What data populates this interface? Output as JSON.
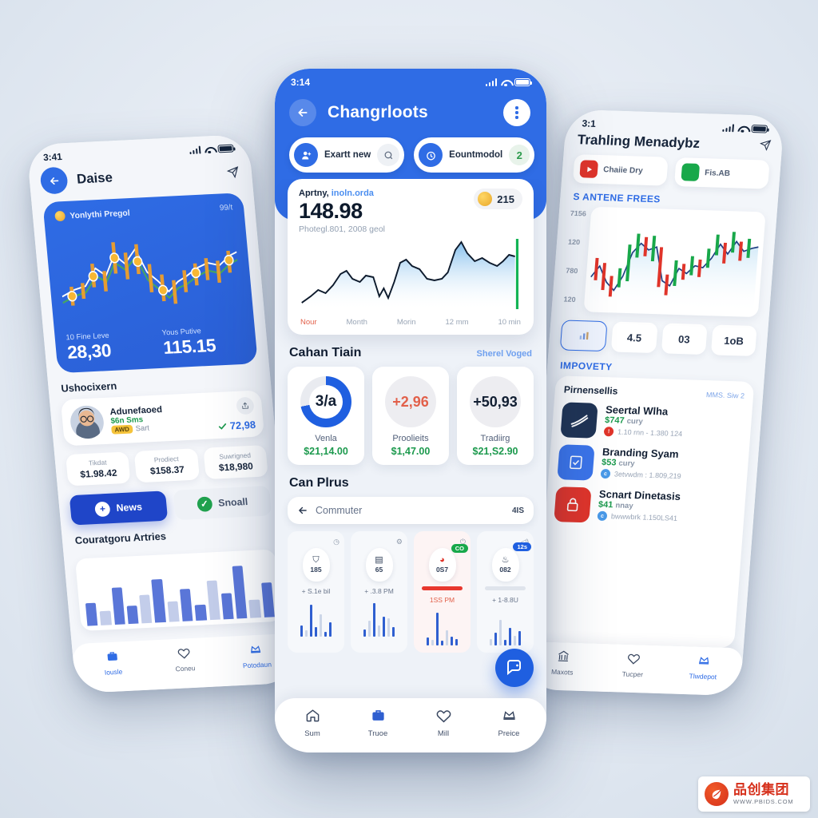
{
  "background_color": "#e6ecf4",
  "accent_blue": "#2f6ce5",
  "accent_green": "#1d9a4e",
  "accent_red": "#e2604a",
  "left_phone": {
    "status": {
      "time": "3:41",
      "icons": [
        "signal-bars",
        "wifi",
        "battery"
      ]
    },
    "header": {
      "back_icon": "arrow-left-icon",
      "title": "Daise",
      "action_icon": "send-icon"
    },
    "hero": {
      "label": "Yonlythi Pregol",
      "right_label": "99/t",
      "chart_type": "candlestick",
      "stats": [
        {
          "label": "10 Fine Leve",
          "value": "28,30"
        },
        {
          "label": "Yous Putive",
          "value": "115.15"
        }
      ]
    },
    "section_title": "Ushocixern",
    "row": {
      "avatar": "user-avatar",
      "name": "Adunefaoed",
      "sub1": "$6n Sms",
      "tag": "AWD",
      "sub2": "Sart",
      "share_icon": "share-icon",
      "check_icon": "check-icon",
      "value": "72,98"
    },
    "stats": [
      {
        "label": "Tikdat",
        "value": "$1.98.42"
      },
      {
        "label": "Prodiect",
        "value": "$158.37"
      },
      {
        "label": "Suwrigned",
        "value": "$18,980"
      }
    ],
    "buttons": [
      {
        "label": "News",
        "icon": "plus-icon",
        "style": "primary"
      },
      {
        "label": "Snoall",
        "icon": "check-circle-icon",
        "style": "ghost"
      }
    ],
    "chart_title": "Couratgoru Artries",
    "nav": [
      {
        "icon": "briefcase-icon",
        "label": "Iousle",
        "active": true
      },
      {
        "icon": "heart-icon",
        "label": "Coneu",
        "active": false
      },
      {
        "icon": "crown-icon",
        "label": "Potodaun",
        "active": true
      }
    ]
  },
  "center_phone": {
    "status": {
      "time": "3:14",
      "icons": [
        "signal-bars",
        "wifi",
        "battery"
      ]
    },
    "header": {
      "back_icon": "arrow-left-icon",
      "title": "Changrloots",
      "menu_icon": "kebab-menu-icon"
    },
    "pills": [
      {
        "icon": "person-add-icon",
        "label": "Exartt new",
        "end_icon": "search-icon"
      },
      {
        "icon": "timer-icon",
        "label": "Eountmodol",
        "badge": "2"
      }
    ],
    "chart_card": {
      "sub_label": "Aprtny,",
      "sub_link": "inoln.orda",
      "value": "148.98",
      "note": "Photegl.801, 2008 geol",
      "coin_icon": "coin-icon",
      "coin_value": "215",
      "axis": [
        "Nour",
        "Month",
        "Morin",
        "12 mm",
        "10 min"
      ]
    },
    "metrics_section": {
      "title": "Cahan Tiain",
      "link": "Sherel Voged"
    },
    "metrics": [
      {
        "ring": "3/a",
        "ring_pct": 72,
        "label": "Venla",
        "value": "$21,14.00",
        "style": "ring"
      },
      {
        "ring": "+2,96",
        "label": "Proolieits",
        "value": "$1,47.00",
        "style": "flat-red"
      },
      {
        "ring": "+50,93",
        "label": "Tradiirg",
        "value": "$21,S2.90",
        "style": "flat-dark"
      }
    ],
    "tiles_section": {
      "title": "Can Plrus"
    },
    "search": {
      "back_icon": "arrow-left-icon",
      "value": "Commuter",
      "right": "4IS"
    },
    "tiles": [
      {
        "top_icon": "clock-icon",
        "glyph": "shield-icon",
        "code": "185",
        "sub": "+ S.1e bil",
        "bars": [
          22,
          8,
          40,
          12,
          28,
          6,
          18
        ]
      },
      {
        "top_icon": "gear-icon",
        "glyph": "doc-icon",
        "code": "65",
        "sub": "+ .3.8 PM",
        "bars": [
          14,
          10,
          44,
          9,
          30,
          26,
          12
        ]
      },
      {
        "top_icon": "power-icon",
        "glyph": "gauge-icon",
        "code": "0S7",
        "chip": "CO",
        "chip_color": "#18a84a",
        "bar_red": true,
        "sub": "1SS PM",
        "bars": [
          12,
          9,
          46,
          7,
          22,
          14,
          10
        ]
      },
      {
        "top_icon": "volume-icon",
        "glyph": "cup-icon",
        "code": "082",
        "chip": "12s",
        "chip_color": "#1f5fe0",
        "sub": "+ 1-8.8U",
        "bars": [
          10,
          16,
          34,
          8,
          24,
          12,
          20
        ]
      }
    ],
    "fab": {
      "icon": "chat-bot-icon"
    },
    "nav": [
      {
        "icon": "home-icon",
        "label": "Sum",
        "active": false
      },
      {
        "icon": "briefcase-icon",
        "label": "Truoe",
        "active": true
      },
      {
        "icon": "heart-icon",
        "label": "Mill",
        "active": false
      },
      {
        "icon": "crown-icon",
        "label": "Preice",
        "active": false
      }
    ]
  },
  "right_phone": {
    "status": {
      "time": "3:1",
      "icons": [
        "signal-bars",
        "wifi",
        "battery"
      ]
    },
    "title": "Trahling Menadybz",
    "action_icon": "send-icon",
    "chips": [
      {
        "icon": "play-icon",
        "label": "Chaiie Dry"
      },
      {
        "icon": "square-icon",
        "label": "Fis.AB"
      }
    ],
    "chart_kicker": "S ANTENE FREES",
    "chart": {
      "type": "candlestick",
      "y_ticks": [
        "7156",
        "120",
        "780",
        "120"
      ]
    },
    "ranges": [
      {
        "label": "",
        "icon": "chart-icon",
        "active": true
      },
      {
        "label": "4.5",
        "active": false
      },
      {
        "label": "03",
        "active": false
      },
      {
        "label": "1oB",
        "active": false
      }
    ],
    "section_title": "IMPOVETY",
    "card": {
      "title": "Pirnensellis",
      "meta": "MMS. Siw 2"
    },
    "items": [
      {
        "thumb": "chart-thumb-navy",
        "thumb_color": "#1f3354",
        "title": "Seertal Wlha",
        "price": "$747",
        "price_unit": "cury",
        "dot_color": "#e0342a",
        "meta": "1.10 rnn - 1.380 124"
      },
      {
        "thumb": "doc-thumb-blue",
        "thumb_color": "#3b74ea",
        "title": "Branding Syam",
        "price": "$53",
        "price_unit": "cury",
        "dot_color": "#4a9ae8",
        "meta": "3etvwdm : 1.809,219"
      },
      {
        "thumb": "lock-thumb-red",
        "thumb_color": "#e0342a",
        "title": "Scnart Dinetasis",
        "price": "$41",
        "price_unit": "nnay",
        "dot_color": "#4a9ae8",
        "meta": "bwwwbrk 1.150LS41"
      }
    ],
    "nav": [
      {
        "icon": "bank-icon",
        "label": "Maxots",
        "active": false
      },
      {
        "icon": "heart-icon",
        "label": "Tucper",
        "active": false
      },
      {
        "icon": "crown-icon",
        "label": "Tlwdepot",
        "active": true
      }
    ]
  },
  "watermark": {
    "logo": "leaf-logo-icon",
    "brand_cn": "品创集团",
    "url": "WWW.PBIDS.COM"
  }
}
